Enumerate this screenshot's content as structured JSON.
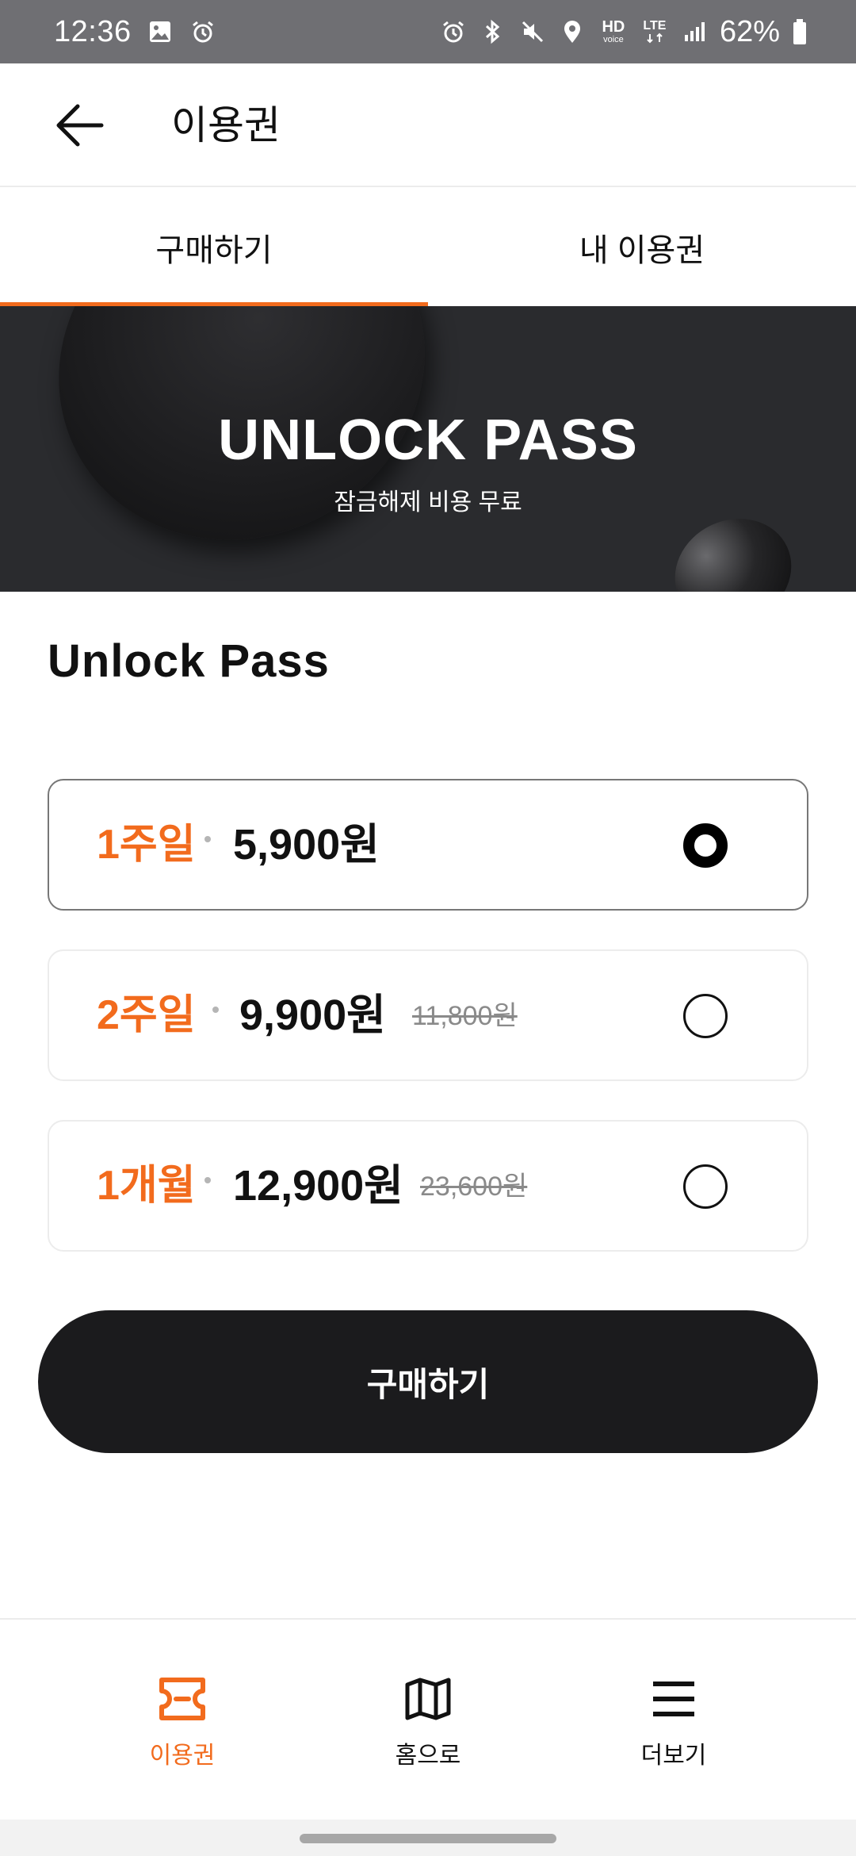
{
  "status_bar": {
    "time": "12:36",
    "battery": "62%",
    "left_icons": [
      "image-icon",
      "alarm-icon"
    ],
    "right_icons": [
      "alarm-icon",
      "bluetooth-icon",
      "mute-icon",
      "location-icon",
      "hd-voice-icon",
      "lte-icon",
      "signal-icon",
      "battery-icon"
    ],
    "hd_label": "HD",
    "voice_label": "voice",
    "lte_label": "LTE"
  },
  "app_bar": {
    "title": "이용권",
    "back_icon": "arrow-left-icon"
  },
  "tabs": [
    {
      "label": "구매하기",
      "active": true
    },
    {
      "label": "내 이용권",
      "active": false
    }
  ],
  "banner": {
    "title": "UNLOCK PASS",
    "subtitle": "잠금해제 비용 무료"
  },
  "section": {
    "title": "Unlock Pass"
  },
  "options": [
    {
      "period": "1주일",
      "price": "5,900원",
      "original_price": "",
      "selected": true
    },
    {
      "period": "2주일",
      "price": "9,900원",
      "original_price": "11,800원",
      "selected": false
    },
    {
      "period": "1개월",
      "price": "12,900원",
      "original_price": "23,600원",
      "selected": false
    }
  ],
  "buy_button": {
    "label": "구매하기"
  },
  "bottom_nav": [
    {
      "label": "이용권",
      "icon": "ticket-icon",
      "active": true
    },
    {
      "label": "홈으로",
      "icon": "map-icon",
      "active": false
    },
    {
      "label": "더보기",
      "icon": "menu-icon",
      "active": false
    }
  ],
  "colors": {
    "accent": "#f26b1d",
    "dark": "#1b1b1d",
    "banner_bg": "#2a2b2e",
    "status_bar_bg": "#6f6f73"
  }
}
